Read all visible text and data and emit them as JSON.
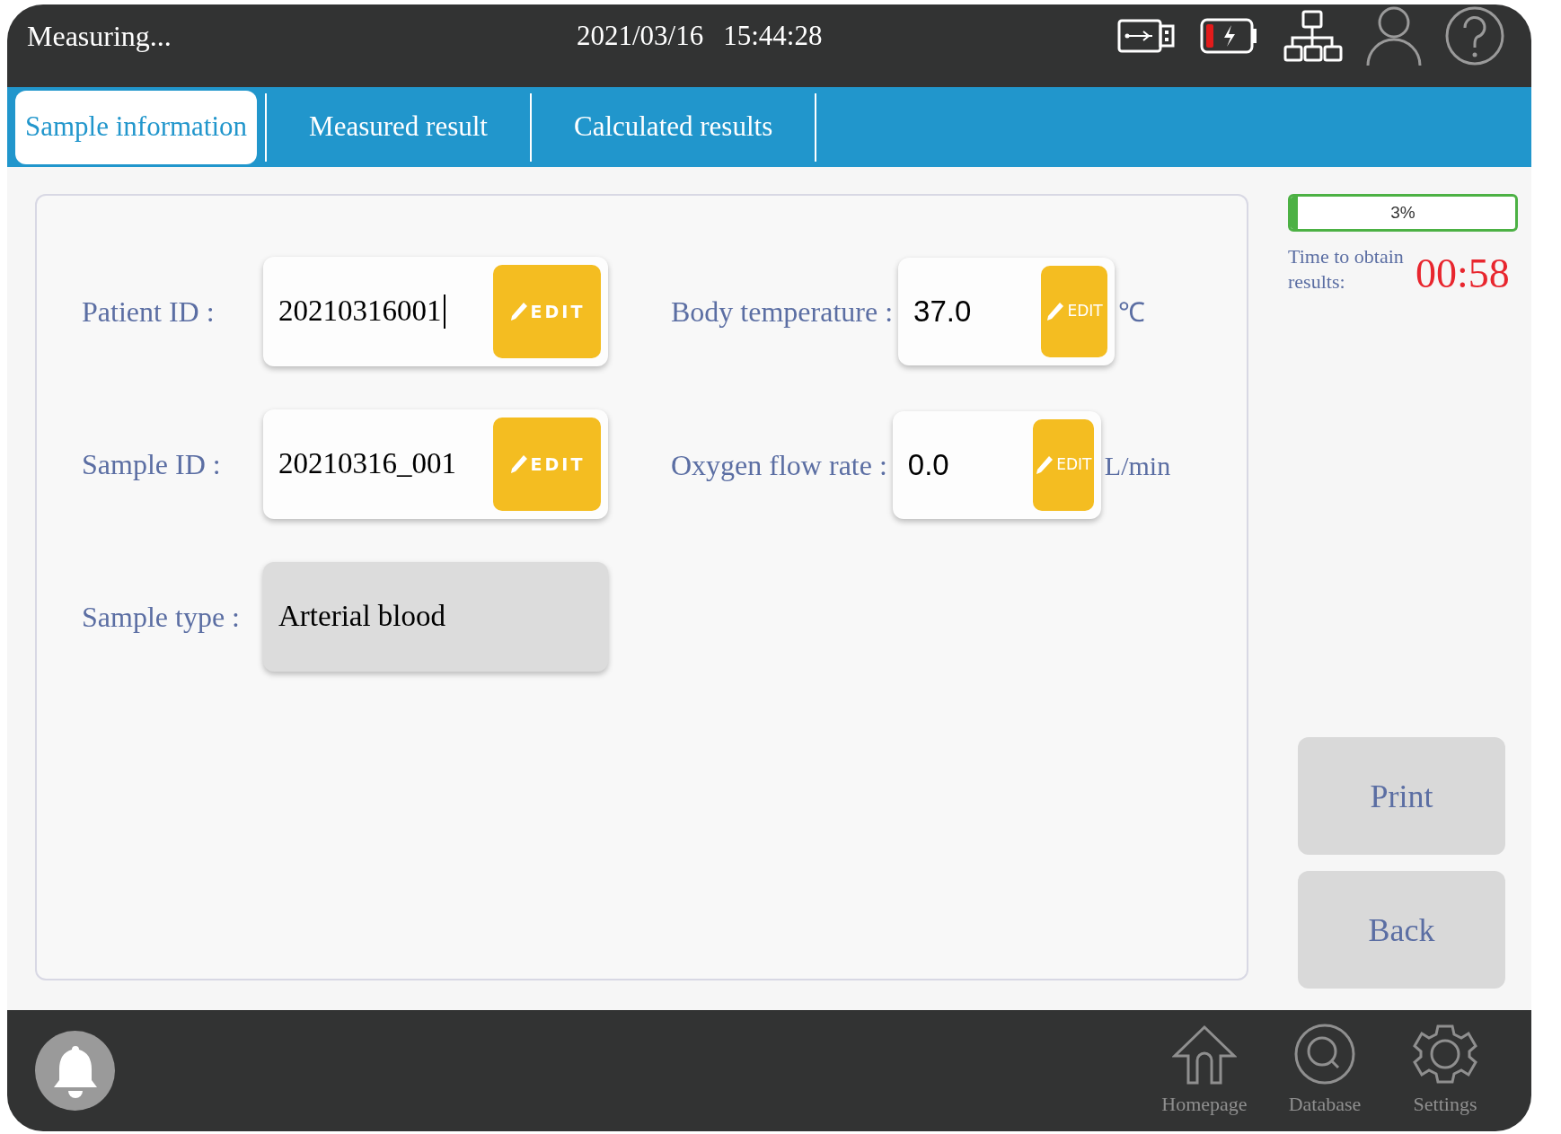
{
  "status_bar": {
    "title": "Measuring...",
    "date": "2021/03/16",
    "time": "15:44:28"
  },
  "tabs": [
    {
      "label": "Sample information",
      "selected": true
    },
    {
      "label": "Measured result",
      "selected": false
    },
    {
      "label": "Calculated results",
      "selected": false
    }
  ],
  "left_fields": [
    {
      "label": "Patient ID :",
      "value": "20210316001",
      "kind": "editable",
      "focused": true,
      "edit": "EDIT"
    },
    {
      "label": "Sample ID :",
      "value": "20210316_001",
      "kind": "editable",
      "focused": false,
      "edit": "EDIT"
    },
    {
      "label": "Sample type :",
      "value": "Arterial blood",
      "kind": "readonly"
    }
  ],
  "right_fields": [
    {
      "label": "Body temperature :",
      "value": "37.0",
      "edit": "EDIT",
      "unit": "℃"
    },
    {
      "label": "Oxygen flow rate :",
      "value": "0.0",
      "edit": "EDIT",
      "unit": "L/min"
    }
  ],
  "progress": {
    "level": 0.03,
    "reading": "3%"
  },
  "timer": {
    "label": "Time to obtain results:",
    "value": "00:58"
  },
  "buttons": [
    "Print",
    "Back"
  ],
  "nav": [
    {
      "label": "Homepage",
      "kind": "home"
    },
    {
      "label": "Database",
      "kind": "database"
    },
    {
      "label": "Settings",
      "kind": "settings"
    }
  ]
}
